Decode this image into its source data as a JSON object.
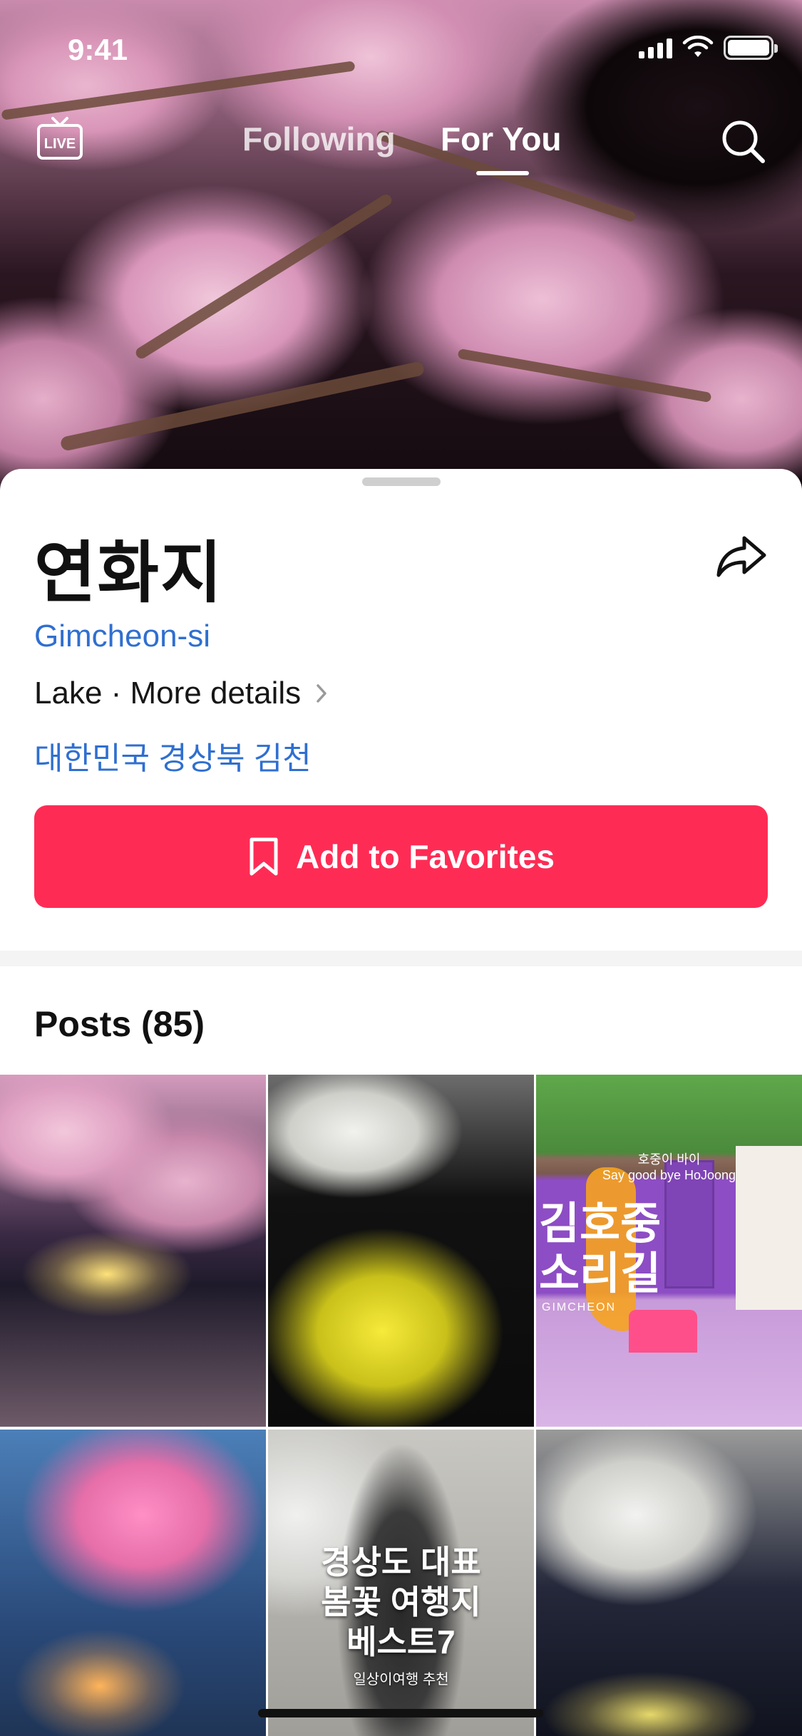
{
  "status_bar": {
    "time": "9:41"
  },
  "top_nav": {
    "live_label": "LIVE",
    "tabs": [
      {
        "label": "Following",
        "active": false
      },
      {
        "label": "For You",
        "active": true
      }
    ]
  },
  "place": {
    "title": "연화지",
    "city": "Gimcheon-si",
    "category": "Lake · More details",
    "address": "대한민국 경상북 김천"
  },
  "actions": {
    "favorite_label": "Add to Favorites"
  },
  "posts": {
    "header": "Posts (85)",
    "items": [
      {
        "id": "post-1",
        "overlay": []
      },
      {
        "id": "post-2",
        "overlay": []
      },
      {
        "id": "post-3",
        "overlay": [
          "호중이 바이",
          "Say good bye HoJoong",
          "김호중",
          "소리길",
          "GIMCHEON"
        ]
      },
      {
        "id": "post-4",
        "overlay": []
      },
      {
        "id": "post-5",
        "overlay": [
          "경상도 대표",
          "봄꽃 여행지",
          "베스트7",
          "일상이여행 추천"
        ]
      },
      {
        "id": "post-6",
        "overlay": []
      }
    ]
  },
  "colors": {
    "accent": "#fe2c55",
    "link": "#2f6fd0",
    "text": "#111111"
  },
  "icons": [
    "live-icon",
    "search-icon",
    "share-icon",
    "chevron-right-icon",
    "bookmark-icon",
    "wifi-icon",
    "signal-icon",
    "battery-icon"
  ]
}
